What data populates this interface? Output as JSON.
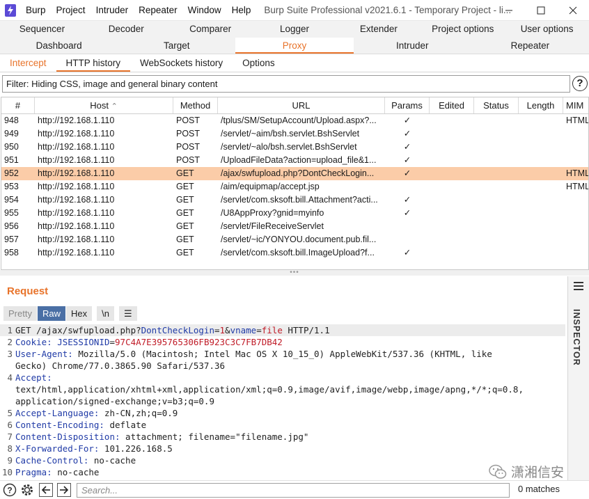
{
  "titlebar": {
    "menus": [
      "Burp",
      "Project",
      "Intruder",
      "Repeater",
      "Window",
      "Help"
    ],
    "title": "Burp Suite Professional v2021.6.1 - Temporary Project - li..."
  },
  "tabs_row1": [
    "Sequencer",
    "Decoder",
    "Comparer",
    "Logger",
    "Extender",
    "Project options",
    "User options"
  ],
  "tabs_row2": [
    "Dashboard",
    "Target",
    "Proxy",
    "Intruder",
    "Repeater"
  ],
  "active_main_tab": "Proxy",
  "subtabs": [
    "Intercept",
    "HTTP history",
    "WebSockets history",
    "Options"
  ],
  "filter": "Filter: Hiding CSS, image and general binary content",
  "help_label": "?",
  "table": {
    "columns": [
      "#",
      "Host",
      "Method",
      "URL",
      "Params",
      "Edited",
      "Status",
      "Length",
      "MIM"
    ],
    "sort_indicator": "⌃",
    "check": "✓",
    "rows": [
      {
        "num": "948",
        "host": "http://192.168.1.110",
        "method": "POST",
        "url": "/tplus/SM/SetupAccount/Upload.aspx?...",
        "params": true,
        "mime": "HTML"
      },
      {
        "num": "949",
        "host": "http://192.168.1.110",
        "method": "POST",
        "url": "/servlet/~aim/bsh.servlet.BshServlet",
        "params": true,
        "mime": ""
      },
      {
        "num": "950",
        "host": "http://192.168.1.110",
        "method": "POST",
        "url": "/servlet/~alo/bsh.servlet.BshServlet",
        "params": true,
        "mime": ""
      },
      {
        "num": "951",
        "host": "http://192.168.1.110",
        "method": "POST",
        "url": "/UploadFileData?action=upload_file&1...",
        "params": true,
        "mime": ""
      },
      {
        "num": "952",
        "host": "http://192.168.1.110",
        "method": "GET",
        "url": "/ajax/swfupload.php?DontCheckLogin...",
        "params": true,
        "mime": "HTML",
        "selected": true
      },
      {
        "num": "953",
        "host": "http://192.168.1.110",
        "method": "GET",
        "url": "/aim/equipmap/accept.jsp",
        "params": false,
        "mime": "HTML"
      },
      {
        "num": "954",
        "host": "http://192.168.1.110",
        "method": "GET",
        "url": "/servlet/com.sksoft.bill.Attachment?acti...",
        "params": true,
        "mime": ""
      },
      {
        "num": "955",
        "host": "http://192.168.1.110",
        "method": "GET",
        "url": "/U8AppProxy?gnid=myinfo",
        "params": true,
        "mime": ""
      },
      {
        "num": "956",
        "host": "http://192.168.1.110",
        "method": "GET",
        "url": "/servlet/FileReceiveServlet",
        "params": false,
        "mime": ""
      },
      {
        "num": "957",
        "host": "http://192.168.1.110",
        "method": "GET",
        "url": "/servlet/~ic/YONYOU.document.pub.fil...",
        "params": false,
        "mime": ""
      },
      {
        "num": "958",
        "host": "http://192.168.1.110",
        "method": "GET",
        "url": "/servlet/com.sksoft.bill.ImageUpload?f...",
        "params": true,
        "mime": ""
      }
    ]
  },
  "request": {
    "title": "Request",
    "toolbar": {
      "pretty": "Pretty",
      "raw": "Raw",
      "hex": "Hex",
      "newline": "\\n",
      "menu": "☰"
    },
    "lines": [
      {
        "n": "1",
        "hl": true,
        "parts": [
          {
            "t": "GET /ajax/swfupload.php?",
            "c": ""
          },
          {
            "t": "DontCheckLogin",
            "c": "p"
          },
          {
            "t": "=",
            "c": ""
          },
          {
            "t": "1",
            "c": "v"
          },
          {
            "t": "&",
            "c": ""
          },
          {
            "t": "vname",
            "c": "p"
          },
          {
            "t": "=",
            "c": ""
          },
          {
            "t": "file",
            "c": "v"
          },
          {
            "t": " HTTP/1.1",
            "c": ""
          }
        ]
      },
      {
        "n": "2",
        "parts": [
          {
            "t": "Cookie:",
            "c": "k"
          },
          {
            "t": " ",
            "c": ""
          },
          {
            "t": "JSESSIONID",
            "c": "p"
          },
          {
            "t": "=",
            "c": ""
          },
          {
            "t": "97C4A7E395765306FB923C3C7FB7DB42",
            "c": "v"
          }
        ]
      },
      {
        "n": "3",
        "parts": [
          {
            "t": "User-Agent:",
            "c": "k"
          },
          {
            "t": " Mozilla/5.0 (Macintosh; Intel Mac OS X 10_15_0) AppleWebKit/537.36 (KHTML, like",
            "c": ""
          }
        ]
      },
      {
        "n": "",
        "parts": [
          {
            "t": "Gecko) Chrome/77.0.3865.90 Safari/537.36",
            "c": ""
          }
        ]
      },
      {
        "n": "4",
        "parts": [
          {
            "t": "Accept:",
            "c": "k"
          }
        ]
      },
      {
        "n": "",
        "parts": [
          {
            "t": "text/html,application/xhtml+xml,application/xml;q=0.9,image/avif,image/webp,image/apng,*/*;q=0.8,",
            "c": ""
          }
        ]
      },
      {
        "n": "",
        "parts": [
          {
            "t": "application/signed-exchange;v=b3;q=0.9",
            "c": ""
          }
        ]
      },
      {
        "n": "5",
        "parts": [
          {
            "t": "Accept-Language:",
            "c": "k"
          },
          {
            "t": " zh-CN,zh;q=0.9",
            "c": ""
          }
        ]
      },
      {
        "n": "6",
        "parts": [
          {
            "t": "Content-Encoding:",
            "c": "k"
          },
          {
            "t": " deflate",
            "c": ""
          }
        ]
      },
      {
        "n": "7",
        "parts": [
          {
            "t": "Content-Disposition:",
            "c": "k"
          },
          {
            "t": " attachment; filename=\"filename.jpg\"",
            "c": ""
          }
        ]
      },
      {
        "n": "8",
        "parts": [
          {
            "t": "X-Forwarded-For:",
            "c": "k"
          },
          {
            "t": " 101.226.168.5",
            "c": ""
          }
        ]
      },
      {
        "n": "9",
        "parts": [
          {
            "t": "Cache-Control:",
            "c": "k"
          },
          {
            "t": " no-cache",
            "c": ""
          }
        ]
      },
      {
        "n": "10",
        "parts": [
          {
            "t": "Pragma:",
            "c": "k"
          },
          {
            "t": " no-cache",
            "c": ""
          }
        ]
      }
    ]
  },
  "inspector": {
    "label": "INSPECTOR"
  },
  "bottom": {
    "search_placeholder": "Search...",
    "matches": "0 matches"
  },
  "watermark": {
    "text": "潇湘信安"
  },
  "colors": {
    "accent": "#e8732a",
    "selected_row": "#fbcca8",
    "raw_active": "#4a6fa5",
    "header_name": "#1f3aa6",
    "value": "#c01c28"
  }
}
